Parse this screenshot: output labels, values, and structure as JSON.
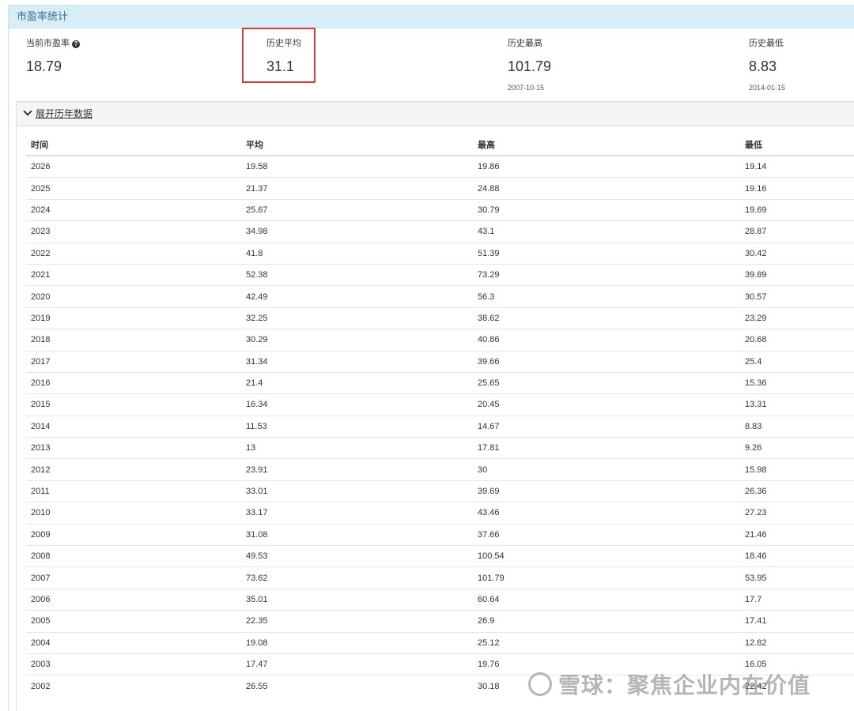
{
  "panel": {
    "title": "市盈率统计"
  },
  "stats": {
    "current": {
      "label": "当前市盈率",
      "value": "18.79",
      "help_icon": "question-circle-icon"
    },
    "average": {
      "label": "历史平均",
      "value": "31.1"
    },
    "highest": {
      "label": "历史最高",
      "value": "101.79",
      "date": "2007-10-15"
    },
    "lowest": {
      "label": "历史最低",
      "value": "8.83",
      "date": "2014-01-15"
    }
  },
  "history": {
    "toggle_label": "展开历年数据",
    "toggle_icon": "chevron-down-icon",
    "columns": [
      "时间",
      "平均",
      "最高",
      "最低"
    ],
    "rows": [
      [
        "2026",
        "19.58",
        "19.86",
        "19.14"
      ],
      [
        "2025",
        "21.37",
        "24.88",
        "19.16"
      ],
      [
        "2024",
        "25.67",
        "30.79",
        "19.69"
      ],
      [
        "2023",
        "34.98",
        "43.1",
        "28.87"
      ],
      [
        "2022",
        "41.8",
        "51.39",
        "30.42"
      ],
      [
        "2021",
        "52.38",
        "73.29",
        "39.89"
      ],
      [
        "2020",
        "42.49",
        "56.3",
        "30.57"
      ],
      [
        "2019",
        "32.25",
        "38.62",
        "23.29"
      ],
      [
        "2018",
        "30.29",
        "40.86",
        "20.68"
      ],
      [
        "2017",
        "31.34",
        "39.66",
        "25.4"
      ],
      [
        "2016",
        "21.4",
        "25.65",
        "15.36"
      ],
      [
        "2015",
        "16.34",
        "20.45",
        "13.31"
      ],
      [
        "2014",
        "11.53",
        "14.67",
        "8.83"
      ],
      [
        "2013",
        "13",
        "17.81",
        "9.26"
      ],
      [
        "2012",
        "23.91",
        "30",
        "15.98"
      ],
      [
        "2011",
        "33.01",
        "39.69",
        "26.36"
      ],
      [
        "2010",
        "33.17",
        "43.46",
        "27.23"
      ],
      [
        "2009",
        "31.08",
        "37.66",
        "21.46"
      ],
      [
        "2008",
        "49.53",
        "100.54",
        "18.46"
      ],
      [
        "2007",
        "73.62",
        "101.79",
        "53.95"
      ],
      [
        "2006",
        "35.01",
        "60.64",
        "17.7"
      ],
      [
        "2005",
        "22.35",
        "26.9",
        "17.41"
      ],
      [
        "2004",
        "19.08",
        "25.12",
        "12.82"
      ],
      [
        "2003",
        "17.47",
        "19.76",
        "16.05"
      ],
      [
        "2002",
        "26.55",
        "30.18",
        "22.42"
      ]
    ]
  },
  "watermark": {
    "text": "雪球：聚焦企业内在价值"
  }
}
